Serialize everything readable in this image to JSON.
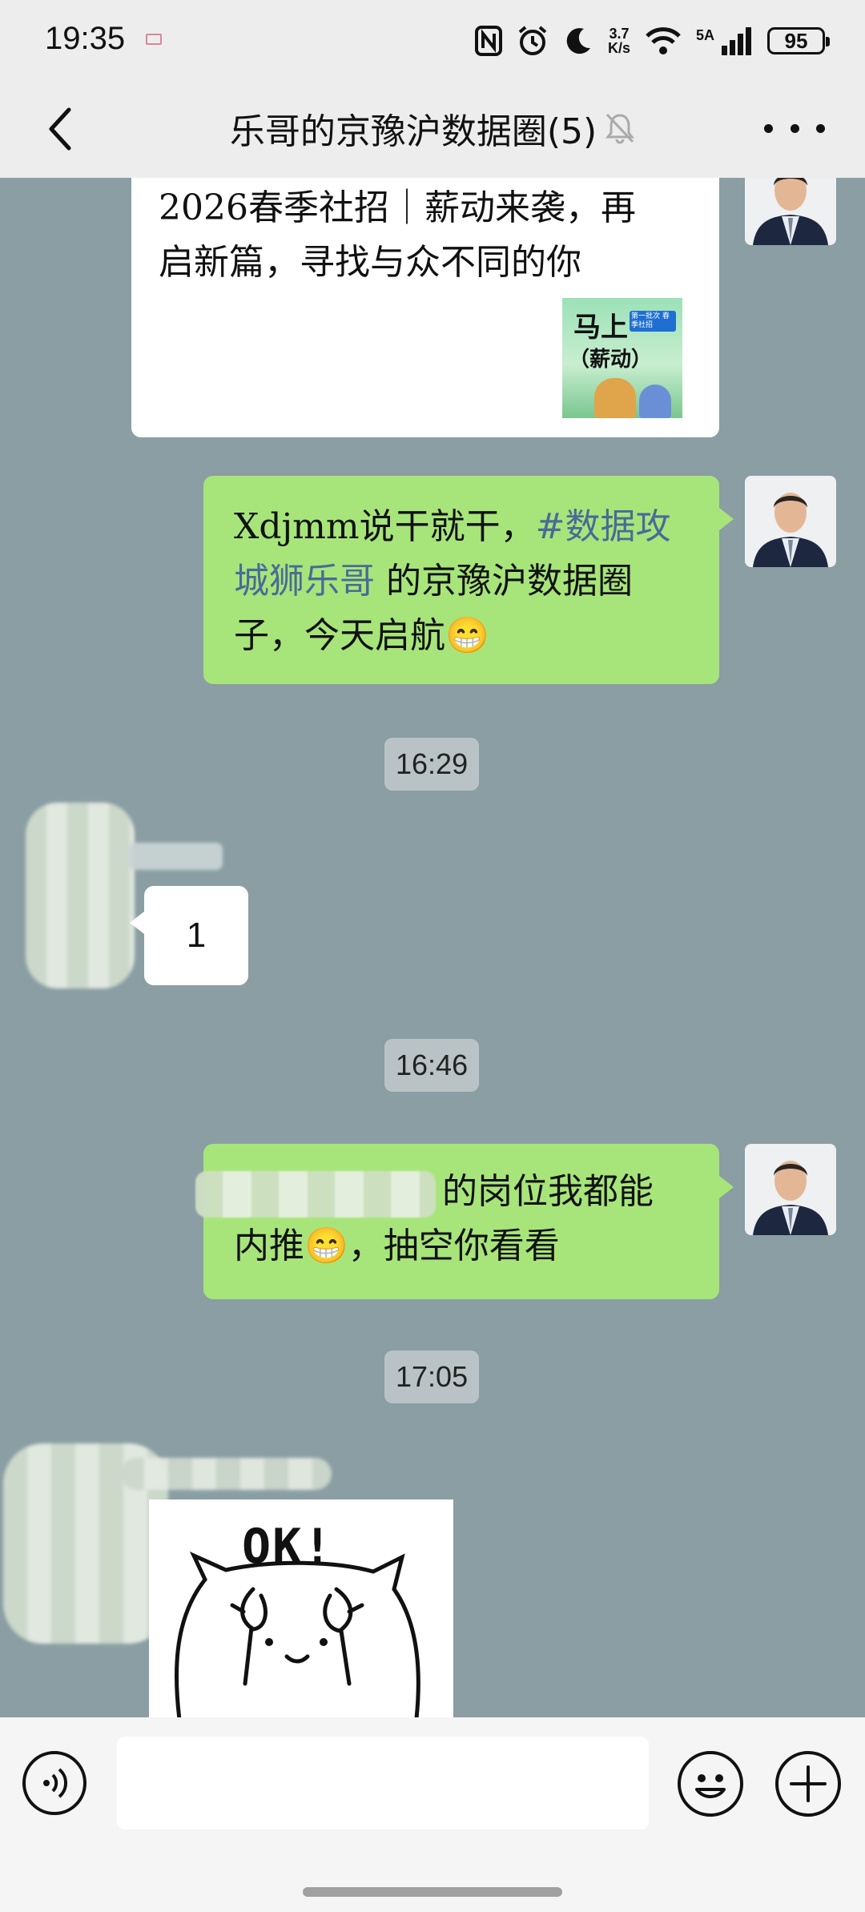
{
  "status_bar": {
    "time": "19:35",
    "net_speed_value": "3.7",
    "net_speed_unit": "K/s",
    "signal_label": "5A",
    "battery": "95",
    "icons": [
      "mail-icon",
      "nfc-icon",
      "alarm-icon",
      "moon-icon",
      "wifi-icon",
      "signal-icon",
      "battery-icon"
    ]
  },
  "header": {
    "back_icon": "chevron-left-icon",
    "title": "乐哥的京豫沪数据圈(5)",
    "muted_icon": "bell-off-icon",
    "more_icon": "more-dots-icon"
  },
  "messages": [
    {
      "type": "card",
      "side": "right",
      "line1": "2026春季社招｜薪动来袭，再",
      "line2": "启新篇，寻找与众不同的你",
      "thumb_title_1": "马上",
      "thumb_title_2": "（薪动）",
      "thumb_badge": "第一批次 春季社招"
    },
    {
      "type": "text",
      "side": "right",
      "line1_a": "Xdjmm说干就干，",
      "line1_b": "#数据攻",
      "line2_a": "城狮乐哥",
      "line2_b": " 的京豫沪数据圈",
      "line3": "子，今天启航😁"
    },
    {
      "type": "time",
      "text": "16:29"
    },
    {
      "type": "text",
      "side": "left",
      "text": "1"
    },
    {
      "type": "time",
      "text": "16:46"
    },
    {
      "type": "text",
      "side": "right",
      "line1_visible": "的岗位我都能",
      "line2": "内推😁，抽空你看看"
    },
    {
      "type": "time",
      "text": "17:05"
    },
    {
      "type": "sticker",
      "side": "left",
      "text": "OK!"
    }
  ],
  "input_bar": {
    "voice_icon": "voice-icon",
    "input_value": "",
    "emoji_icon": "emoji-icon",
    "plus_icon": "plus-icon"
  },
  "colors": {
    "chat_background": "#8a9ea3",
    "sent_bubble": "#a7e57a",
    "received_bubble": "#ffffff",
    "bar_background": "#ededed",
    "link": "#4a6a98"
  }
}
